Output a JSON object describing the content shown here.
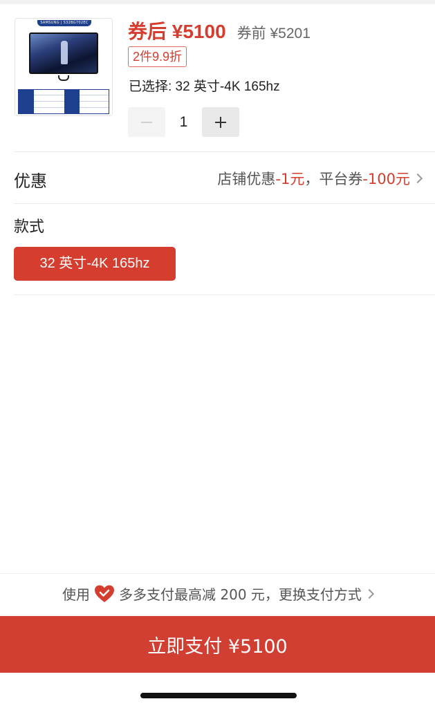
{
  "product": {
    "thumb_brand": "SAMSUNG | S32BG702EC",
    "price_after_coupon": "券后 ¥5100",
    "price_before_coupon": "券前 ¥5201",
    "deal_tag": "2件9.9折",
    "selected": "已选择: 32 英寸-4K 165hz",
    "quantity": "1",
    "minus_icon": "minus-icon",
    "plus_icon": "plus-icon"
  },
  "discount": {
    "label": "优惠",
    "shop_text": "店铺优惠",
    "shop_amount": "-1元",
    "separator": "，",
    "platform_text": "平台券",
    "platform_amount": "-100元"
  },
  "style": {
    "label": "款式",
    "options": [
      "32 英寸-4K 165hz"
    ],
    "selected_index": 0
  },
  "payment": {
    "prefix": "使用",
    "icon": "heart-icon",
    "tip": "多多支付最高减 200 元，更换支付方式",
    "button_label": "立即支付 ¥5100"
  },
  "colors": {
    "accent": "#d53d2f",
    "pay_button": "#d03f31"
  }
}
